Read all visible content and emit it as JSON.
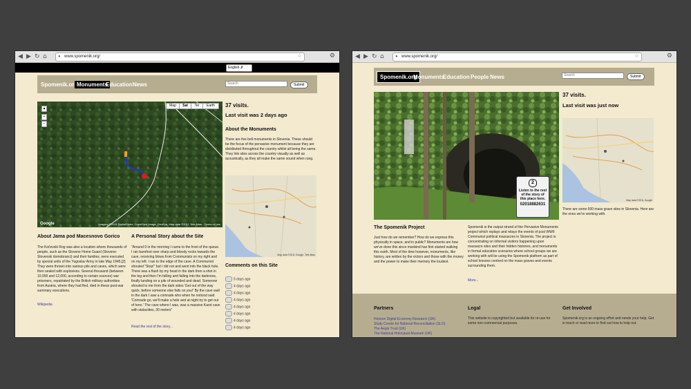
{
  "left": {
    "browser": {
      "url": "www.spomenik.org/"
    },
    "lang": {
      "selected": "English"
    },
    "nav": {
      "logo": "Spomenik.org",
      "items": [
        "Monuments",
        "Education",
        "News"
      ],
      "search_placeholder": "Search",
      "submit": "Submit"
    },
    "map": {
      "types": [
        "Map",
        "Sat",
        "Ter",
        "Earth"
      ],
      "copyright": "Imagery ©2011 DigitalGlobe, Cnes/Spot Image, GeoEye, Map data ©2011 Tele Atlas - Terms of Use",
      "google": "Google"
    },
    "stats": {
      "visits": "37 visits.",
      "last_visit": "Last visit was 2 days ago"
    },
    "about_monuments": {
      "title": "About the Monuments",
      "text": "There are five bell monuments in Slovenia. These should be the focus of the pervasive monument because they are distributed throughout the country whilst all being the same. They link sites across the country visually as well as acoustically, as they all make the same sound when rung."
    },
    "small_map": {
      "copyright": "Map data ©2011 Google, Tele Atlas"
    },
    "about_site": {
      "title": "About Jama pod Macesnovo Gorico",
      "text": "The Kočevski Rog was also a location where thousands of people, such as the Slovene Home Guard (Slovene: Slovenski domobranci) and their families, were executed by special units of the Yugoslav Army in late May 1945.[2] They were thrown into various pits and caves, which were then sealed with explosives. Several thousand (between 10,000 and 12,000, according to certain sources) war prisoners, repatriated by the British military authorities from Austria, where they had fled, died in these post-war summary executions.",
      "link": "Wikipedia"
    },
    "story": {
      "title": "A Personal Story about the Site",
      "text": "\"Around 9 in the morning I came to the front of the queue. I ran barefoot over sharp and bloody rocks towards the cave, receiving blows from Communists on my right and on my left. I ran to the edge of the cave. A Communist shouted \"Stop!\" but I did not and went into the black hole. There was a flash by my head in the dark then a shot in the leg and then I'm falling and falling into the darkness, finally landing on a pile of wounded and dead. Someone shouted to me from the dark sides 'Get out of the way quick, before someone else falls on you!' By the cave wall in the dark I saw a comrade who when he noticed said 'Comrade go, we'll make a hole and at night try to get out of here.' The cave where I was, was a massive Karst cave with stalactites, 30 meters\"",
      "link": "Read the rest of the story..."
    },
    "comments": {
      "title": "Comments on this Site",
      "items": [
        "5 days ago",
        "4 days ago",
        "4 days ago",
        "4 days ago",
        "4 days ago",
        "4 days ago",
        "4 days ago",
        "4 days ago"
      ]
    }
  },
  "right": {
    "browser": {
      "url": "www.spomenik.org/"
    },
    "nav": {
      "logo": "Spomenik.org",
      "items": [
        "Monuments",
        "Education",
        "People",
        "News"
      ],
      "search_placeholder": "Search",
      "submit": "Submit"
    },
    "stats": {
      "visits": "37 visits.",
      "last_visit": "Last visit was just now"
    },
    "sign": {
      "number": "2",
      "text": "Listen to the rest of the story of this place here.",
      "phone": "02018882631"
    },
    "map_text": "There are some 600 mass grave sites in Slovenia. Here are the ones we're working with.",
    "map_copyright": "Map data ©2011 Google",
    "project": {
      "title": "The Spomenik Project",
      "text": "Just how do we remember? How do we express this physically in space, and in public? Monuments are how we've done this since mankind has first started walking this earth. Most of the time however, monuments, like history, are written by the victors and those with the money and the power to make their memory the loudest."
    },
    "strand": {
      "text": "Spomenik is the output strand of the Pervasive Monuments project which replays and relays the events of post WWII Communist political massacres in Slovenia. The project is concentrating on informal visitors happening upon massacre sites and their hidden histories, and monuments in formal education scenarios where school groups we are working with will be using the Spomenik platform as part of school lessons centred on the mass graves and events surrounding them.",
      "more": "More..."
    },
    "footer": {
      "partners": {
        "title": "Partners",
        "links": [
          "Horizon Digital Economy Research (UK)",
          "Study Centre for National Reconciliation (SLO)",
          "The Aegis Trust (UK)",
          "The National Holocaust Museum (UK)"
        ]
      },
      "legal": {
        "title": "Legal",
        "text": "This website is copyrighted but available for re-use for some non-commercial purposes."
      },
      "involved": {
        "title": "Get Involved",
        "text": "Spomenik.org is an ongoing effort and needs your help. Get in touch or read more to find out how to help out."
      }
    }
  },
  "colors": {
    "page_bg": "#f3ead0",
    "nav_bg": "#b6ad90",
    "desktop": "#3f3f3f",
    "link": "#3b3b9a"
  }
}
